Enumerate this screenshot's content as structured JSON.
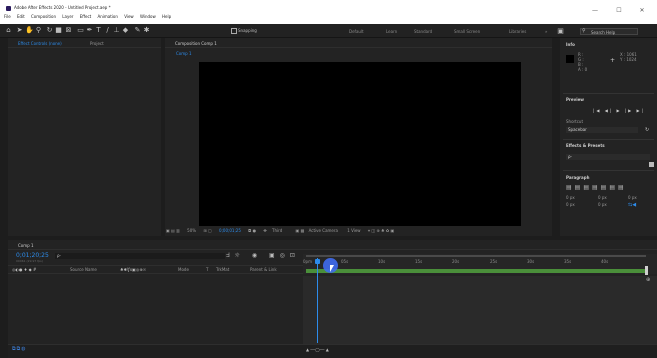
{
  "titlebar": {
    "title": "Adobe After Effects 2020 - Untitled Project.aep *",
    "menu": [
      "File",
      "Edit",
      "Composition",
      "Layer",
      "Effect",
      "Animation",
      "View",
      "Window",
      "Help"
    ],
    "minimize": "—",
    "maximize": "☐",
    "close": "✕"
  },
  "toolbar": {
    "snapping_label": "Snapping",
    "workspaces": [
      "Default",
      "Learn",
      "Standard",
      "Small Screen",
      "Libraries"
    ],
    "search_placeholder": "Search Help",
    "expand_glyph": "»"
  },
  "left_panel": {
    "tabs": [
      "Effect Controls (none)",
      "Project"
    ]
  },
  "comp_panel": {
    "tab": "Composition Comp 1",
    "breadcrumb": "Comp 1",
    "zoom": "50%",
    "timecode": "0;00;01;25",
    "resolution": "Third",
    "camera": "Active Camera",
    "view": "1 View"
  },
  "right_panel": {
    "info_title": "Info",
    "info_values": [
      "R :",
      "G :",
      "B :",
      "A : 0"
    ],
    "info_xy": [
      "X : 1061",
      "Y : 1024"
    ],
    "preview_title": "Preview",
    "preview_controls": [
      "|◀",
      "◀|",
      "▶",
      "|▶",
      "▶|"
    ],
    "shortcut_label": "Shortcut",
    "shortcut_value": "Spacebar",
    "effects_title": "Effects & Presets",
    "effects_search": "ρ-",
    "paragraph_title": "Paragraph",
    "paragraph_values": [
      "0 px",
      "0 px",
      "0 px",
      "0 px",
      "0 px"
    ]
  },
  "timeline": {
    "tab": "Comp 1",
    "timecode": "0;01;20;25",
    "timecode_sub": "00061 (29.97 fps)",
    "search": "ρ-",
    "columns": [
      "Source Name",
      "Mode",
      "T",
      "TrkMat",
      "Parent & Link"
    ],
    "ruler": [
      "0pm",
      "05s",
      "10s",
      "15s",
      "20s",
      "25s",
      "30s",
      "35s",
      "40s"
    ]
  },
  "colors": {
    "accent_blue": "#2d8ceb",
    "green_bar": "#4a8f3a",
    "cursor_highlight": "#3f6cf0"
  }
}
